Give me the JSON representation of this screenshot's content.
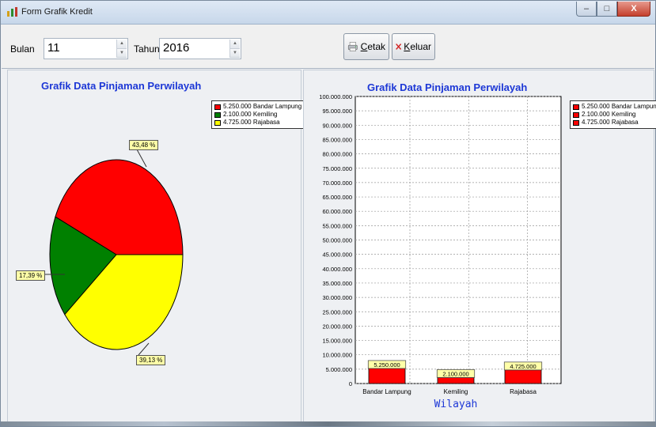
{
  "window": {
    "title": "Form Grafik Kredit"
  },
  "titlebar_buttons": {
    "minimize": "–",
    "maximize": "□",
    "close": "X"
  },
  "toolbar": {
    "bulan_label": "Bulan",
    "bulan_value": "11",
    "tahun_label": "Tahun",
    "tahun_value": "2016",
    "cetak_label": "etak",
    "cetak_accel": "C",
    "keluar_label": "eluar",
    "keluar_accel": "K"
  },
  "icons": [
    "app-icon",
    "printer-icon",
    "close-x-icon",
    "spin-up-icon",
    "spin-down-icon"
  ],
  "colors": {
    "red": "#ff0000",
    "green": "#008000",
    "yellow": "#ffff00",
    "title_blue": "#1d38d6",
    "tag_bg": "#ffffa8"
  },
  "pie_panel": {
    "title": "Grafik Data Pinjaman Perwilayah",
    "legend": [
      {
        "text": "5.250.000 Bandar Lampung",
        "color": "#ff0000"
      },
      {
        "text": "2.100.000 Kemiling",
        "color": "#008000"
      },
      {
        "text": "4.725.000 Rajabasa",
        "color": "#ffff00"
      }
    ]
  },
  "bar_panel": {
    "title": "Grafik Data Pinjaman Perwilayah",
    "legend": [
      {
        "text": "5.250.000 Bandar Lampung",
        "color": "#ff0000"
      },
      {
        "text": "2.100.000 Kemiling",
        "color": "#ff0000"
      },
      {
        "text": "4.725.000 Rajabasa",
        "color": "#ff0000"
      }
    ]
  },
  "chart_data": [
    {
      "type": "pie",
      "title": "Grafik Data Pinjaman Perwilayah",
      "categories": [
        "Bandar Lampung",
        "Kemiling",
        "Rajabasa"
      ],
      "values": [
        5250000,
        2100000,
        4725000
      ],
      "percent_labels": [
        "43,48 %",
        "17,39 %",
        "39,13 %"
      ],
      "colors": [
        "#ff0000",
        "#008000",
        "#ffff00"
      ],
      "legend": "top-right"
    },
    {
      "type": "bar",
      "title": "Grafik Data Pinjaman Perwilayah",
      "categories": [
        "Bandar Lampung",
        "Kemiling",
        "Rajabasa"
      ],
      "values": [
        5250000,
        2100000,
        4725000
      ],
      "value_labels": [
        "5.250.000",
        "2.100.000",
        "4.725.000"
      ],
      "xlabel": "Wilayah",
      "ylabel": "",
      "ylim": [
        0,
        100000000
      ],
      "y_ticks": [
        "0",
        "5.000.000",
        "10.000.000",
        "15.000.000",
        "20.000.000",
        "25.000.000",
        "30.000.000",
        "35.000.000",
        "40.000.000",
        "45.000.000",
        "50.000.000",
        "55.000.000",
        "60.000.000",
        "65.000.000",
        "70.000.000",
        "75.000.000",
        "80.000.000",
        "85.000.000",
        "90.000.000",
        "95.000.000",
        "100.000.000"
      ],
      "grid": true,
      "legend": "top-right",
      "color": "#ff0000"
    }
  ]
}
